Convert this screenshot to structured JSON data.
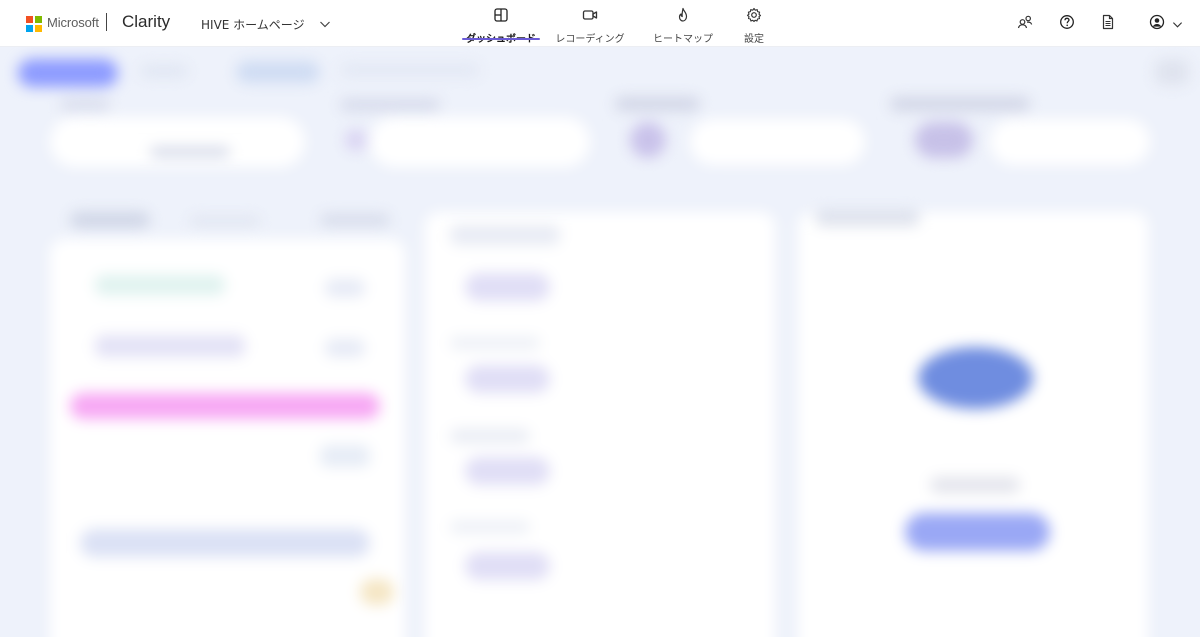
{
  "header": {
    "company_name": "Microsoft",
    "product_name": "Clarity",
    "project_name": "HIVE ホームページ",
    "logo_colors": [
      "#f25022",
      "#7fba00",
      "#00a4ef",
      "#ffb900"
    ],
    "accent_color": "#6b5bd6"
  },
  "nav": [
    {
      "label": "ダッシュボード",
      "icon": "dashboard-icon",
      "active": true
    },
    {
      "label": "レコーディング",
      "icon": "video-camera-icon",
      "active": false
    },
    {
      "label": "ヒートマップ",
      "icon": "flame-icon",
      "active": false
    },
    {
      "label": "設定",
      "icon": "gear-icon",
      "active": false
    }
  ],
  "toolbar": [
    {
      "icon": "people-icon"
    },
    {
      "icon": "help-icon"
    },
    {
      "icon": "document-icon"
    },
    {
      "icon": "account-icon"
    }
  ]
}
